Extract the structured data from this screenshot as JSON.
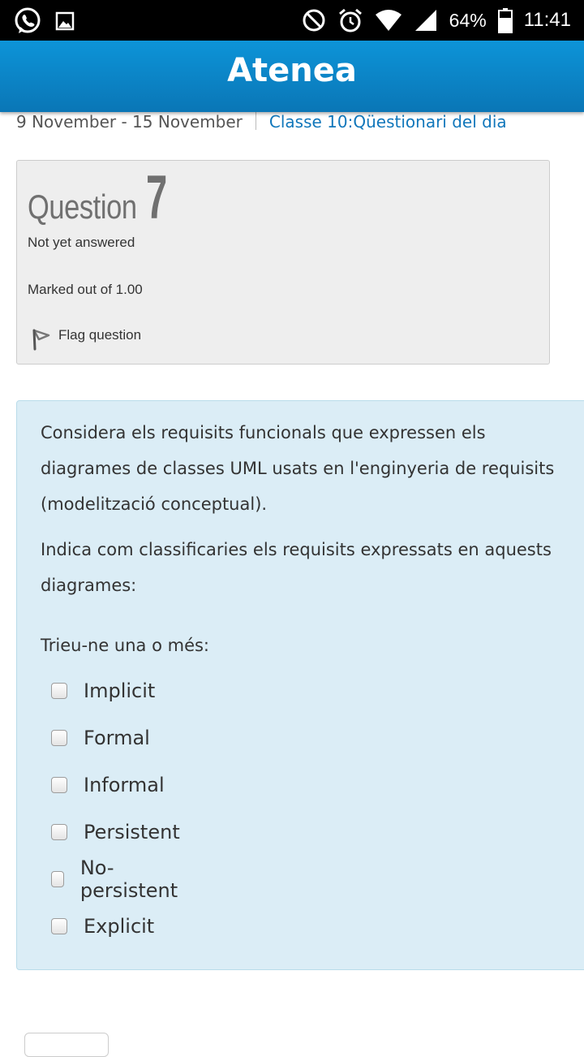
{
  "status_bar": {
    "battery_percent": "64%",
    "time": "11:41",
    "icons": [
      "whatsapp-icon",
      "image-icon",
      "do-not-disturb-icon",
      "alarm-icon",
      "wifi-icon",
      "signal-icon",
      "battery-icon"
    ]
  },
  "app_bar": {
    "title": "Atenea"
  },
  "breadcrumb": {
    "week": "9 November - 15 November",
    "link": "Classe 10:Qüestionari del dia"
  },
  "question_info": {
    "label": "Question",
    "number": "7",
    "state": "Not yet answered",
    "marked": "Marked out of 1.00",
    "flag_label": "Flag question"
  },
  "question": {
    "paragraph1": "Considera els requisits funcionals que expressen els diagrames de classes UML usats en l'enginyeria de requisits (modelització conceptual).",
    "paragraph2": "Indica com classificaries els requisits expressats en aquests diagrames:",
    "prompt": "Trieu-ne una o més:",
    "options": [
      {
        "label": "Implicit",
        "checked": false
      },
      {
        "label": "Formal",
        "checked": false
      },
      {
        "label": "Informal",
        "checked": false
      },
      {
        "label": "Persistent",
        "checked": false
      },
      {
        "label": "No-persistent",
        "checked": false
      },
      {
        "label": "Explicit",
        "checked": false
      }
    ]
  },
  "colors": {
    "app_bar": "#0a84c8",
    "link": "#1177bb",
    "formulation_bg": "#dbedf6",
    "info_bg": "#eeeeee"
  }
}
